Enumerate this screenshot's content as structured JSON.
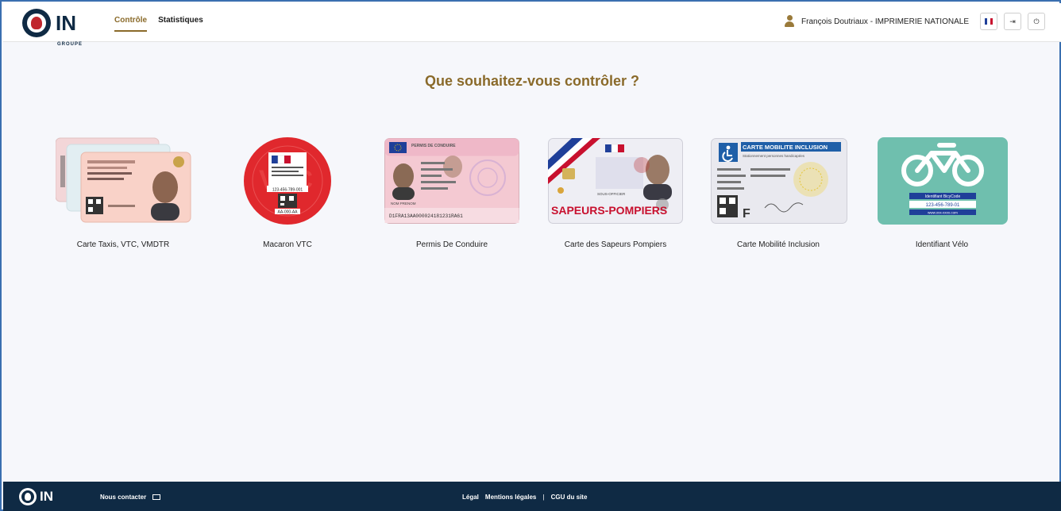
{
  "header": {
    "logo_text": "IN",
    "logo_sub": "GROUPE",
    "tabs": [
      {
        "label": "Contrôle",
        "active": true
      },
      {
        "label": "Statistiques",
        "active": false
      }
    ],
    "user_name": "François Doutriaux - IMPRIMERIE NATIONALE",
    "buttons": [
      {
        "name": "language-flag-button",
        "icon": "flag-fr-icon"
      },
      {
        "name": "logout-button",
        "icon": "exit-icon",
        "glyph": "⇥"
      },
      {
        "name": "power-button",
        "icon": "power-icon",
        "glyph": "⏻"
      }
    ]
  },
  "main": {
    "title": "Que souhaitez-vous contrôler ?",
    "cards": [
      {
        "label": "Carte Taxis, VTC, VMDTR",
        "image": "taxi-vtc-cards-image"
      },
      {
        "label": "Macaron VTC",
        "image": "vtc-macaron-image",
        "lines": [
          "VTC",
          "123-456-789-001",
          "AA-000-AA"
        ]
      },
      {
        "label": "Permis De Conduire",
        "image": "driving-licence-image",
        "lines": [
          "PERMIS DE CONDUIRE",
          "D1FRA13AA000024181231RA61",
          "NOM PRENOM"
        ]
      },
      {
        "label": "Carte des Sapeurs Pompiers",
        "image": "firefighters-card-image",
        "lines": [
          "SAPEURS-POMPIERS",
          "SOUS-OFFICIER"
        ]
      },
      {
        "label": "Carte Mobilité Inclusion",
        "image": "mobility-inclusion-card-image",
        "lines": [
          "CARTE MOBILITE INCLUSION",
          "Stationnement personnes handicapées",
          "F"
        ]
      },
      {
        "label": "Identifiant Vélo",
        "image": "bike-identifier-image",
        "lines": [
          "Identifiant BicyCode",
          "123-456-789-01",
          "www.xxx-xxxx.com"
        ]
      }
    ]
  },
  "footer": {
    "logo_text": "IN",
    "contact_label": "Nous contacter",
    "links": [
      "Légal",
      "Mentions légales",
      "CGU du site"
    ]
  },
  "colors": {
    "accent": "#8a6a2a",
    "navy": "#0f2a44",
    "background": "#f6f7fb",
    "bike_card": "#6fbfae"
  }
}
